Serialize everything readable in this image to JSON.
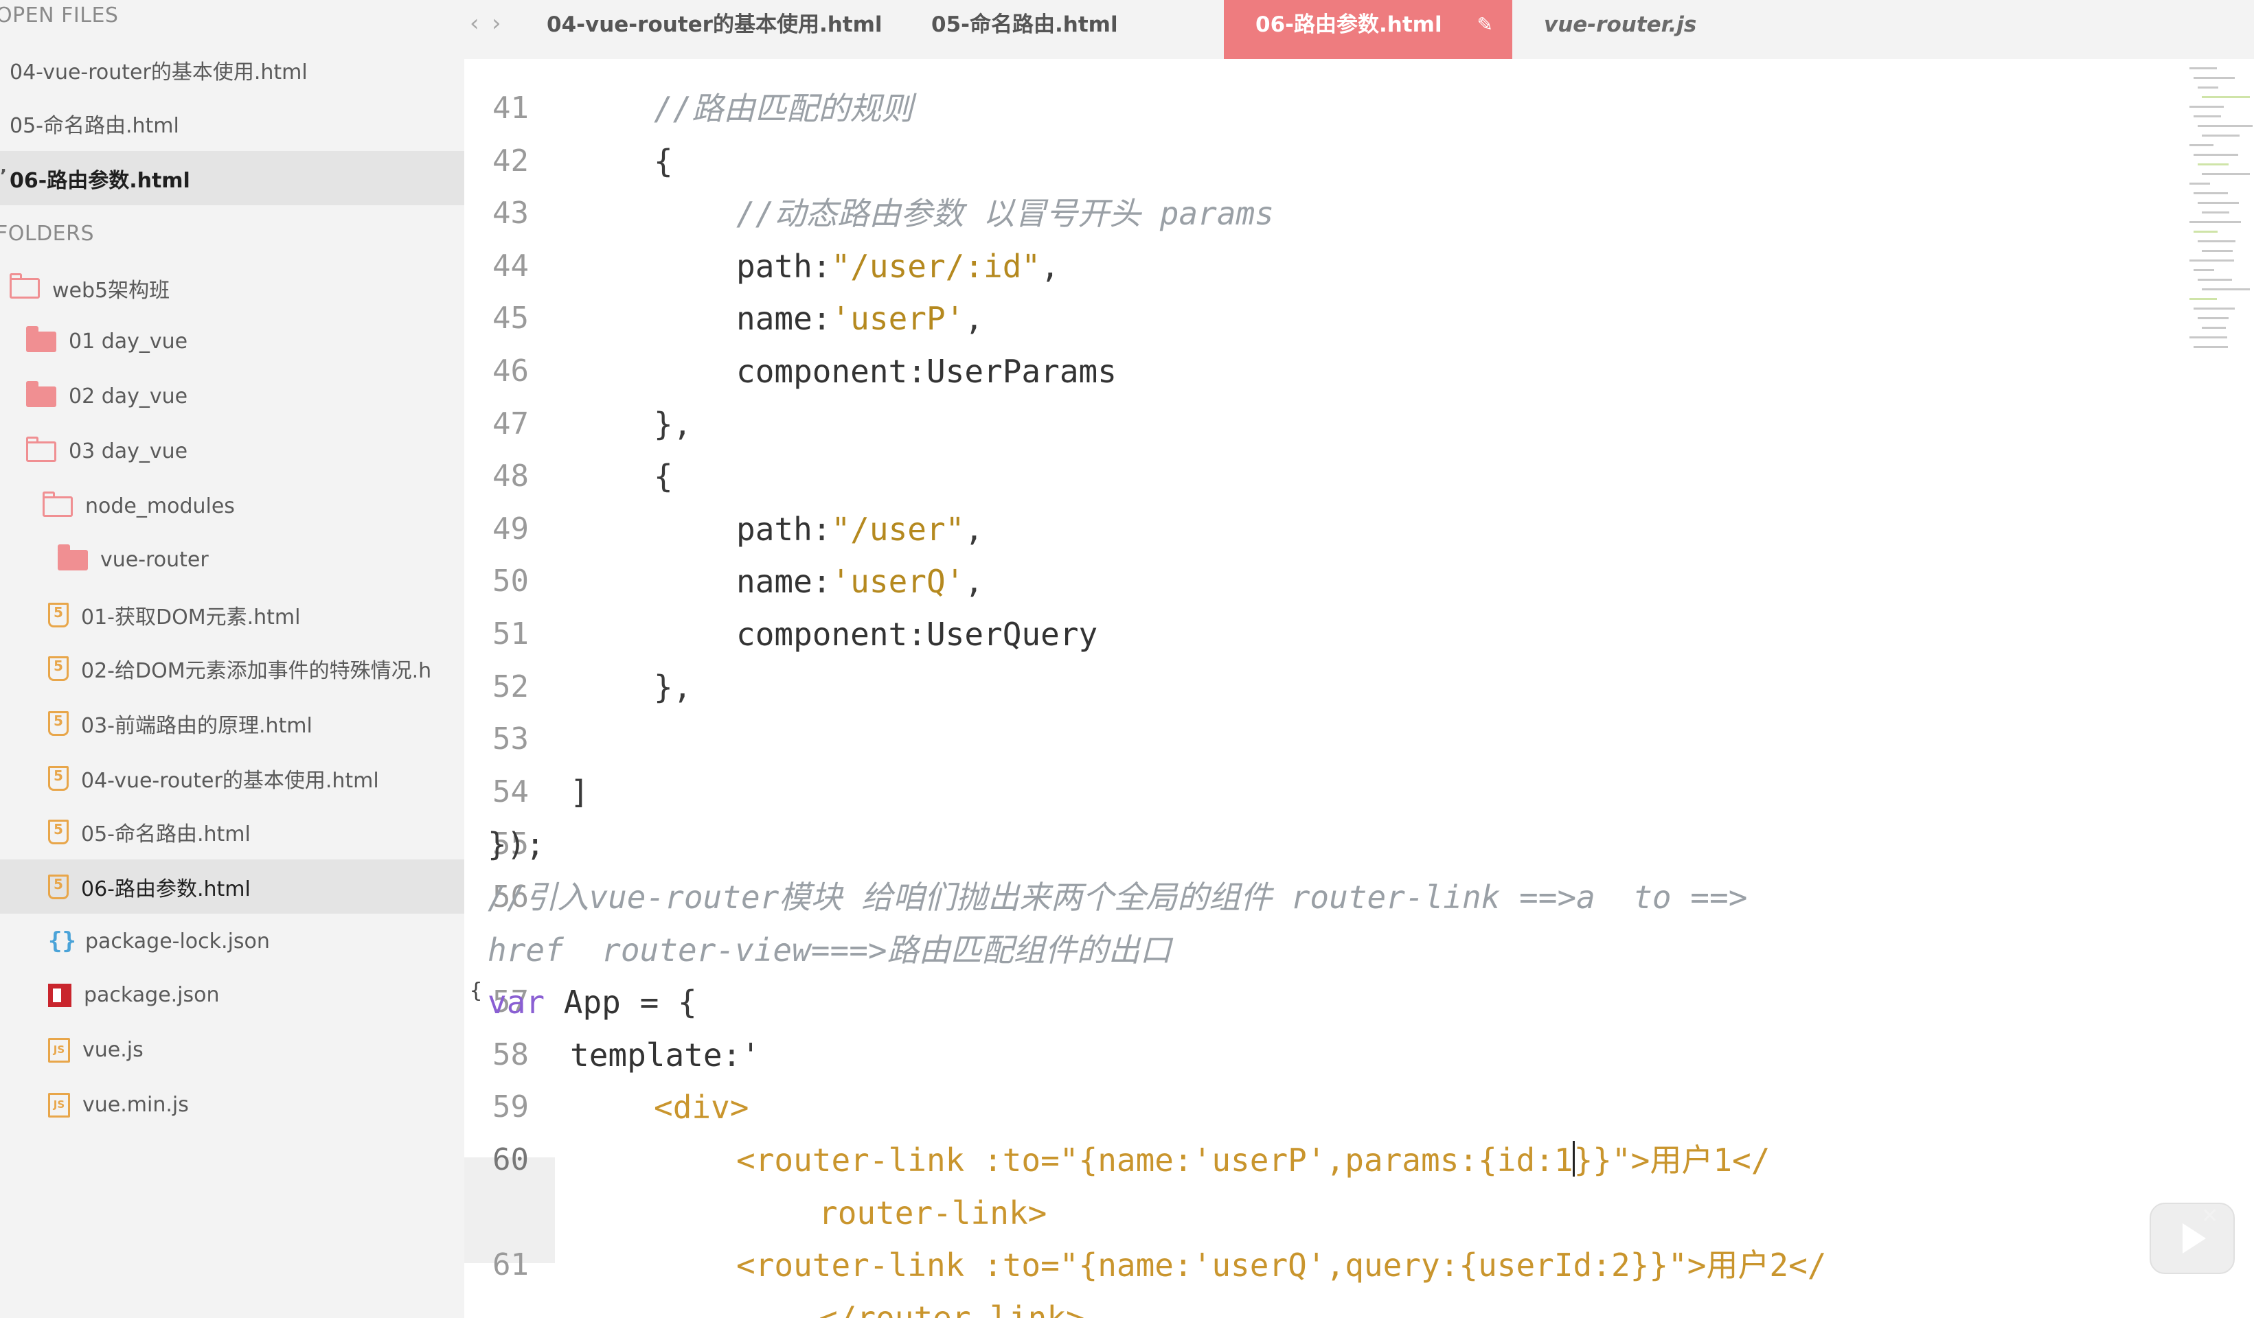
{
  "sidebar": {
    "open_files_header": "OPEN FILES",
    "open_files": [
      {
        "label": "04-vue-router的基本使用.html",
        "selected": false
      },
      {
        "label": "05-命名路由.html",
        "selected": false
      },
      {
        "label": "06-路由参数.html",
        "selected": true
      }
    ],
    "folders_header": "FOLDERS",
    "tree": [
      {
        "label": "web5架构班",
        "icon": "folder-open-icon",
        "depth": 0
      },
      {
        "label": "01 day_vue",
        "icon": "folder-closed-icon",
        "depth": 1
      },
      {
        "label": "02 day_vue",
        "icon": "folder-closed-icon",
        "depth": 1
      },
      {
        "label": "03 day_vue",
        "icon": "folder-open-icon",
        "depth": 1
      },
      {
        "label": "node_modules",
        "icon": "folder-open-icon",
        "depth": 2
      },
      {
        "label": "vue-router",
        "icon": "folder-closed-icon",
        "depth": 3
      },
      {
        "label": "01-获取DOM元素.html",
        "icon": "html5-file-icon",
        "depth": 2
      },
      {
        "label": "02-给DOM元素添加事件的特殊情况.h",
        "icon": "html5-file-icon",
        "depth": 2
      },
      {
        "label": "03-前端路由的原理.html",
        "icon": "html5-file-icon",
        "depth": 2
      },
      {
        "label": "04-vue-router的基本使用.html",
        "icon": "html5-file-icon",
        "depth": 2
      },
      {
        "label": "05-命名路由.html",
        "icon": "html5-file-icon",
        "depth": 2
      },
      {
        "label": "06-路由参数.html",
        "icon": "html5-file-icon",
        "depth": 2,
        "selected": true
      },
      {
        "label": "package-lock.json",
        "icon": "json-file-icon",
        "depth": 2
      },
      {
        "label": "package.json",
        "icon": "npm-file-icon",
        "depth": 2
      },
      {
        "label": "vue.js",
        "icon": "js-file-icon",
        "depth": 2
      },
      {
        "label": "vue.min.js",
        "icon": "js-file-icon",
        "depth": 2
      }
    ]
  },
  "tabs": [
    {
      "label": "04-vue-router的基本使用.html",
      "active": false
    },
    {
      "label": "05-命名路由.html",
      "active": false
    },
    {
      "label": "06-路由参数.html",
      "active": true
    },
    {
      "label": "vue-router.js",
      "active": false
    }
  ],
  "nav": {
    "back": "‹",
    "forward": "›"
  },
  "editor": {
    "active_line": "60",
    "lines": [
      {
        "num": "41",
        "segments": [
          {
            "t": "//路由匹配的规则",
            "c": "cm"
          }
        ]
      },
      {
        "num": "42",
        "segments": [
          {
            "t": "{",
            "c": "pun"
          }
        ]
      },
      {
        "num": "43",
        "segments": [
          {
            "t": "//动态路由参数 以冒号开头 params",
            "c": "cm"
          }
        ]
      },
      {
        "num": "44",
        "segments": [
          {
            "t": "path",
            "c": "id"
          },
          {
            "t": ":",
            "c": "pun"
          },
          {
            "t": "\"/user/:id\"",
            "c": "str"
          },
          {
            "t": ",",
            "c": "pun"
          }
        ]
      },
      {
        "num": "45",
        "segments": [
          {
            "t": "name",
            "c": "id"
          },
          {
            "t": ":",
            "c": "pun"
          },
          {
            "t": "'userP'",
            "c": "str"
          },
          {
            "t": ",",
            "c": "pun"
          }
        ]
      },
      {
        "num": "46",
        "segments": [
          {
            "t": "component",
            "c": "id"
          },
          {
            "t": ":",
            "c": "pun"
          },
          {
            "t": "UserParams",
            "c": "id"
          }
        ]
      },
      {
        "num": "47",
        "segments": [
          {
            "t": "},",
            "c": "pun"
          }
        ]
      },
      {
        "num": "48",
        "segments": [
          {
            "t": "{",
            "c": "pun"
          }
        ]
      },
      {
        "num": "49",
        "segments": [
          {
            "t": "path",
            "c": "id"
          },
          {
            "t": ":",
            "c": "pun"
          },
          {
            "t": "\"/user\"",
            "c": "str"
          },
          {
            "t": ",",
            "c": "pun"
          }
        ]
      },
      {
        "num": "50",
        "segments": [
          {
            "t": "name",
            "c": "id"
          },
          {
            "t": ":",
            "c": "pun"
          },
          {
            "t": "'userQ'",
            "c": "str"
          },
          {
            "t": ",",
            "c": "pun"
          }
        ]
      },
      {
        "num": "51",
        "segments": [
          {
            "t": "component",
            "c": "id"
          },
          {
            "t": ":",
            "c": "pun"
          },
          {
            "t": "UserQuery",
            "c": "id"
          }
        ]
      },
      {
        "num": "52",
        "segments": [
          {
            "t": "},",
            "c": "pun"
          }
        ]
      },
      {
        "num": "53",
        "segments": []
      },
      {
        "num": "54",
        "segments": [
          {
            "t": "]",
            "c": "pun"
          }
        ]
      },
      {
        "num": "55",
        "segments": [
          {
            "t": "});",
            "c": "pun"
          }
        ]
      },
      {
        "num": "56",
        "segments": [
          {
            "t": "//引入vue-router模块 给咱们抛出来两个全局的组件 router-link ==>a  to ==>",
            "c": "cm"
          }
        ]
      },
      {
        "num": "",
        "segments": [
          {
            "t": "href  router-view===>路由匹配组件的出口",
            "c": "cm"
          }
        ]
      },
      {
        "num": "57",
        "segments": [
          {
            "t": "var",
            "c": "kw"
          },
          {
            "t": " App ",
            "c": "id"
          },
          {
            "t": "=",
            "c": "op"
          },
          {
            "t": " {",
            "c": "pun"
          }
        ]
      },
      {
        "num": "58",
        "segments": [
          {
            "t": "template",
            "c": "id"
          },
          {
            "t": ":'",
            "c": "pun"
          }
        ]
      },
      {
        "num": "59",
        "segments": [
          {
            "t": "<div>",
            "c": "tag"
          }
        ]
      },
      {
        "num": "60",
        "segments": [
          {
            "t": "<router-link :to=\"{name:'userP',params:{id:1",
            "c": "tag"
          },
          {
            "t": "|",
            "c": "cursor"
          },
          {
            "t": "}}\">用户1</",
            "c": "tag"
          }
        ]
      },
      {
        "num": "",
        "segments": [
          {
            "t": "router-link>",
            "c": "tag"
          }
        ]
      },
      {
        "num": "61",
        "segments": [
          {
            "t": "<router-link :to=\"{name:'userQ',query:{userId:2}}\">用户2</",
            "c": "tag"
          }
        ]
      },
      {
        "num": "",
        "segments": [
          {
            "t": "</router-link>",
            "c": "tag"
          }
        ]
      }
    ]
  },
  "colors": {
    "active_tab": "#ee7c7f",
    "string": "#b5891f",
    "keyword": "#8a5fd3",
    "comment": "#9aa0a6",
    "tag": "#c9952d"
  }
}
